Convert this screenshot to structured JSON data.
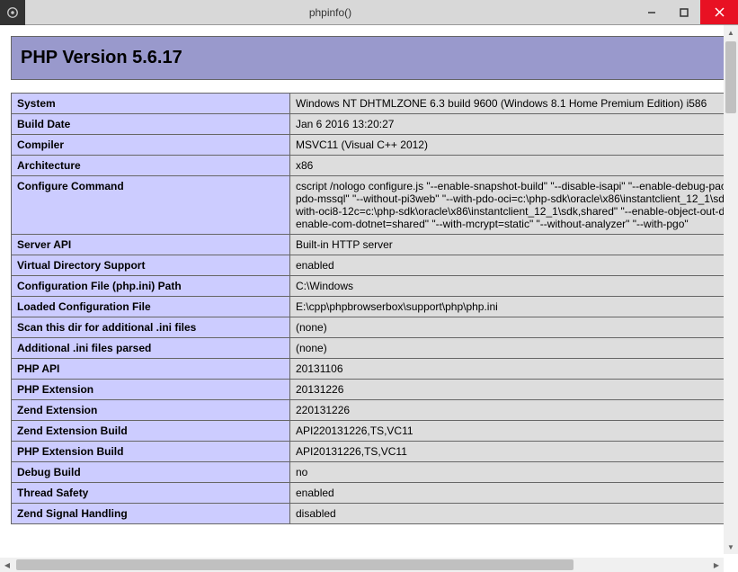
{
  "window": {
    "title": "phpinfo()"
  },
  "header": {
    "title": "PHP Version 5.6.17"
  },
  "rows": [
    {
      "label": "System",
      "value": "Windows NT DHTMLZONE 6.3 build 9600 (Windows 8.1 Home Premium Edition) i586"
    },
    {
      "label": "Build Date",
      "value": "Jan 6 2016 13:20:27"
    },
    {
      "label": "Compiler",
      "value": "MSVC11 (Visual C++ 2012)"
    },
    {
      "label": "Architecture",
      "value": "x86"
    },
    {
      "label": "Configure Command",
      "value": "cscript /nologo configure.js \"--enable-snapshot-build\" \"--disable-isapi\" \"--enable-debug-pack\" \"--without-pdo-mssql\" \"--without-pi3web\" \"--with-pdo-oci=c:\\php-sdk\\oracle\\x86\\instantclient_12_1\\sdk,shared\" \"--with-oci8-12c=c:\\php-sdk\\oracle\\x86\\instantclient_12_1\\sdk,shared\" \"--enable-object-out-dir=../obj/\" \"--enable-com-dotnet=shared\" \"--with-mcrypt=static\" \"--without-analyzer\" \"--with-pgo\""
    },
    {
      "label": "Server API",
      "value": "Built-in HTTP server"
    },
    {
      "label": "Virtual Directory Support",
      "value": "enabled"
    },
    {
      "label": "Configuration File (php.ini) Path",
      "value": "C:\\Windows"
    },
    {
      "label": "Loaded Configuration File",
      "value": "E:\\cpp\\phpbrowserbox\\support\\php\\php.ini"
    },
    {
      "label": "Scan this dir for additional .ini files",
      "value": "(none)"
    },
    {
      "label": "Additional .ini files parsed",
      "value": "(none)"
    },
    {
      "label": "PHP API",
      "value": "20131106"
    },
    {
      "label": "PHP Extension",
      "value": "20131226"
    },
    {
      "label": "Zend Extension",
      "value": "220131226"
    },
    {
      "label": "Zend Extension Build",
      "value": "API220131226,TS,VC11"
    },
    {
      "label": "PHP Extension Build",
      "value": "API20131226,TS,VC11"
    },
    {
      "label": "Debug Build",
      "value": "no"
    },
    {
      "label": "Thread Safety",
      "value": "enabled"
    },
    {
      "label": "Zend Signal Handling",
      "value": "disabled"
    }
  ]
}
